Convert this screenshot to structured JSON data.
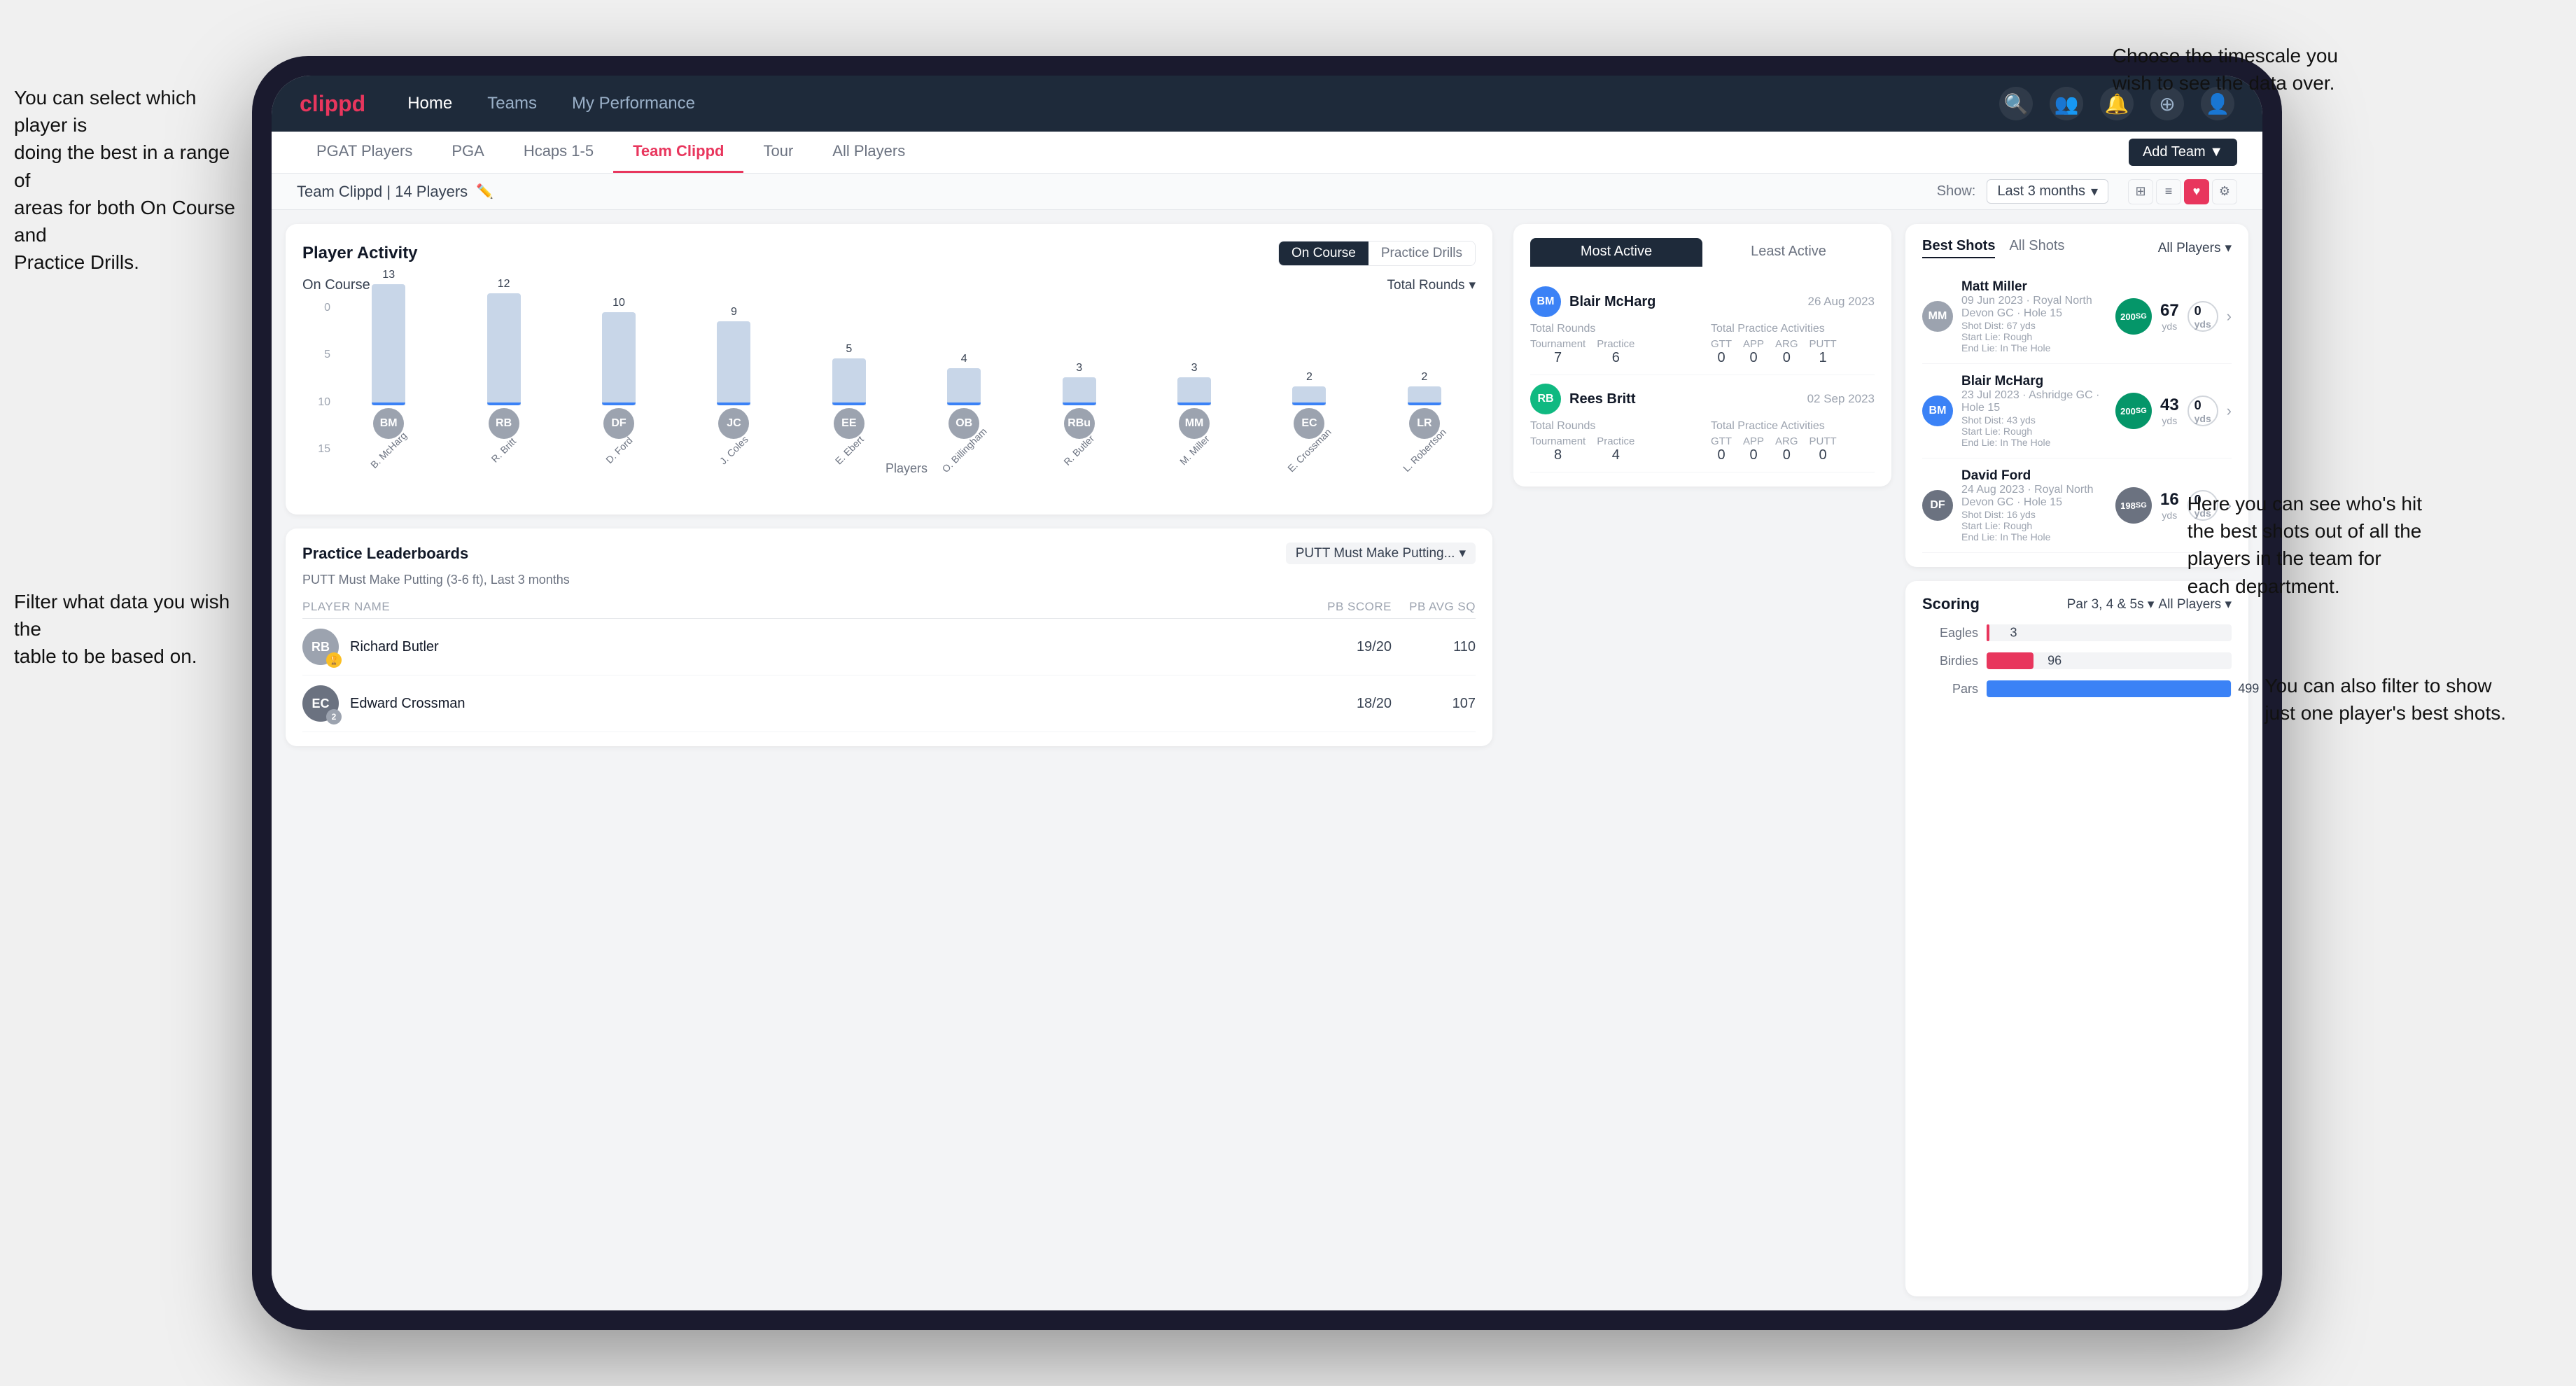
{
  "annotations": {
    "top_right": "Choose the timescale you\nwish to see the data over.",
    "left_top": "You can select which player is\ndoing the best in a range of\nareas for both On Course and\nPractice Drills.",
    "left_bottom": "Filter what data you wish the\ntable to be based on.",
    "right_mid": "Here you can see who's hit\nthe best shots out of all the\nplayers in the team for\neach department.",
    "right_bottom": "You can also filter to show\njust one player's best shots."
  },
  "nav": {
    "logo": "clippd",
    "items": [
      "Home",
      "Teams",
      "My Performance"
    ],
    "subnav": [
      "PGAT Players",
      "PGA",
      "Hcaps 1-5",
      "Team Clippd",
      "Tour",
      "All Players"
    ],
    "active_sub": "Team Clippd",
    "add_team_btn": "Add Team ▼"
  },
  "team_header": {
    "name": "Team Clippd | 14 Players",
    "show_label": "Show:",
    "time_filter": "Last 3 months",
    "dropdown_arrow": "▾"
  },
  "player_activity": {
    "title": "Player Activity",
    "toggle_on_course": "On Course",
    "toggle_practice": "Practice Drills",
    "section_label": "On Course",
    "chart_filter": "Total Rounds",
    "y_labels": [
      "15",
      "10",
      "5",
      "0"
    ],
    "y_axis_title": "Total Rounds",
    "bars": [
      {
        "name": "B. McHarg",
        "value": 13,
        "initials": "BM",
        "color": "#8ba7c2"
      },
      {
        "name": "R. Britt",
        "value": 12,
        "initials": "RB",
        "color": "#8ba7c2"
      },
      {
        "name": "D. Ford",
        "value": 10,
        "initials": "DF",
        "color": "#8ba7c2"
      },
      {
        "name": "J. Coles",
        "value": 9,
        "initials": "JC",
        "color": "#8ba7c2"
      },
      {
        "name": "E. Ebert",
        "value": 5,
        "initials": "EE",
        "color": "#8ba7c2"
      },
      {
        "name": "O. Billingham",
        "value": 4,
        "initials": "OB",
        "color": "#8ba7c2"
      },
      {
        "name": "R. Butler",
        "value": 3,
        "initials": "RBu",
        "color": "#8ba7c2"
      },
      {
        "name": "M. Miller",
        "value": 3,
        "initials": "MM",
        "color": "#8ba7c2"
      },
      {
        "name": "E. Crossman",
        "value": 2,
        "initials": "EC",
        "color": "#8ba7c2"
      },
      {
        "name": "L. Robertson",
        "value": 2,
        "initials": "LR",
        "color": "#8ba7c2"
      }
    ],
    "x_axis_label": "Players"
  },
  "practice_leaderboards": {
    "title": "Practice Leaderboards",
    "filter": "PUTT Must Make Putting...",
    "subtitle": "PUTT Must Make Putting (3-6 ft), Last 3 months",
    "columns": [
      "PLAYER NAME",
      "PB SCORE",
      "PB AVG SQ"
    ],
    "players": [
      {
        "name": "Richard Butler",
        "initials": "RB",
        "badge": "🏆",
        "rank": 1,
        "pb_score": "19/20",
        "pb_avg": "110",
        "color": "#6b7280"
      },
      {
        "name": "Edward Crossman",
        "initials": "EC",
        "badge": "2",
        "rank": 2,
        "pb_score": "18/20",
        "pb_avg": "107",
        "color": "#6b7280"
      }
    ]
  },
  "most_active": {
    "tabs": [
      "Most Active",
      "Least Active"
    ],
    "active_tab": "Most Active",
    "players": [
      {
        "name": "Blair McHarg",
        "date": "26 Aug 2023",
        "initials": "BM",
        "color": "#3b82f6",
        "total_rounds_label": "Total Rounds",
        "tournament": "7",
        "practice": "6",
        "total_practice_label": "Total Practice Activities",
        "gtt": "0",
        "app": "0",
        "arg": "0",
        "putt": "1"
      },
      {
        "name": "Rees Britt",
        "date": "02 Sep 2023",
        "initials": "RB",
        "color": "#10b981",
        "total_rounds_label": "Total Rounds",
        "tournament": "8",
        "practice": "4",
        "total_practice_label": "Total Practice Activities",
        "gtt": "0",
        "app": "0",
        "arg": "0",
        "putt": "0"
      }
    ]
  },
  "best_shots": {
    "title_tab1": "Best Shots",
    "title_tab2": "All Shots",
    "players_filter": "All Players",
    "shots": [
      {
        "player": "Matt Miller",
        "date": "09 Jun 2023",
        "course": "Royal North Devon GC",
        "hole": "Hole 15",
        "initials": "MM",
        "color": "#9ca3af",
        "badge_num": "200",
        "badge_label": "SG",
        "shot_dist": "Shot Dist: 67 yds",
        "start_lie": "Start Lie: Rough",
        "end_lie": "End Lie: In The Hole",
        "dist1": "67",
        "dist1_label": "yds",
        "dist2": "0",
        "dist2_label": "yds"
      },
      {
        "player": "Blair McHarg",
        "date": "23 Jul 2023",
        "course": "Ashridge GC",
        "hole": "Hole 15",
        "initials": "BM",
        "color": "#3b82f6",
        "badge_num": "200",
        "badge_label": "SG",
        "shot_dist": "Shot Dist: 43 yds",
        "start_lie": "Start Lie: Rough",
        "end_lie": "End Lie: In The Hole",
        "dist1": "43",
        "dist1_label": "yds",
        "dist2": "0",
        "dist2_label": "yds"
      },
      {
        "player": "David Ford",
        "date": "24 Aug 2023",
        "course": "Royal North Devon GC",
        "hole": "Hole 15",
        "initials": "DF",
        "color": "#6b7280",
        "badge_num": "198",
        "badge_label": "SG",
        "shot_dist": "Shot Dist: 16 yds",
        "start_lie": "Start Lie: Rough",
        "end_lie": "End Lie: In The Hole",
        "dist1": "16",
        "dist1_label": "yds",
        "dist2": "0",
        "dist2_label": "yds"
      }
    ]
  },
  "scoring": {
    "title": "Scoring",
    "filter1": "Par 3, 4 & 5s",
    "filter2": "All Players",
    "bars": [
      {
        "label": "Eagles",
        "value": 3,
        "max": 500,
        "color": "#e8365d",
        "display": "3"
      },
      {
        "label": "Birdies",
        "value": 96,
        "max": 500,
        "color": "#e8365d",
        "display": "96"
      },
      {
        "label": "Pars",
        "value": 499,
        "max": 500,
        "color": "#3b82f6",
        "display": "499"
      }
    ]
  }
}
